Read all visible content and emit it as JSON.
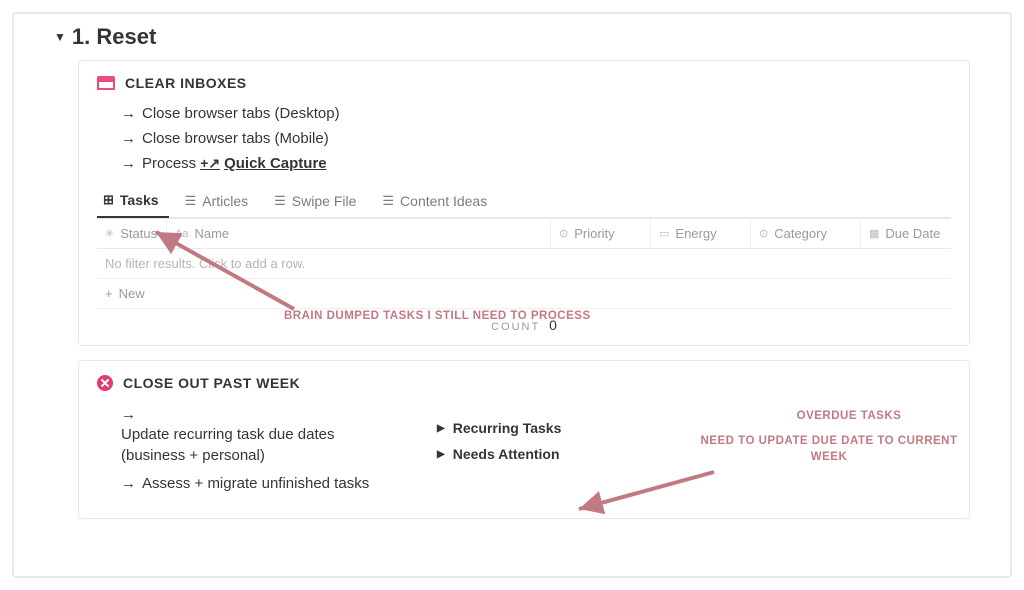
{
  "header": {
    "title": "1. Reset"
  },
  "clear_inboxes": {
    "title": "CLEAR INBOXES",
    "steps": [
      "Close browser tabs (Desktop)",
      "Close browser tabs (Mobile)",
      "Process"
    ],
    "quick_capture": "Quick Capture",
    "tabs": [
      "Tasks",
      "Articles",
      "Swipe File",
      "Content Ideas"
    ],
    "columns": [
      "Status",
      "Name",
      "Priority",
      "Energy",
      "Category",
      "Due Date"
    ],
    "empty_text": "No filter results. Click to add a row.",
    "new_label": "New",
    "count_label": "COUNT",
    "count_value": "0"
  },
  "close_out": {
    "title": "CLOSE OUT PAST WEEK",
    "steps": [
      "Update recurring task due dates (business + personal)",
      "Assess + migrate unfinished tasks"
    ],
    "db_toggles": [
      "Recurring Tasks",
      "Needs Attention"
    ]
  },
  "annotations": {
    "top": "BRAIN DUMPED TASKS I STILL NEED TO PROCESS",
    "right1": "OVERDUE TASKS",
    "right2": "NEED TO UPDATE DUE DATE TO CURRENT WEEK"
  }
}
